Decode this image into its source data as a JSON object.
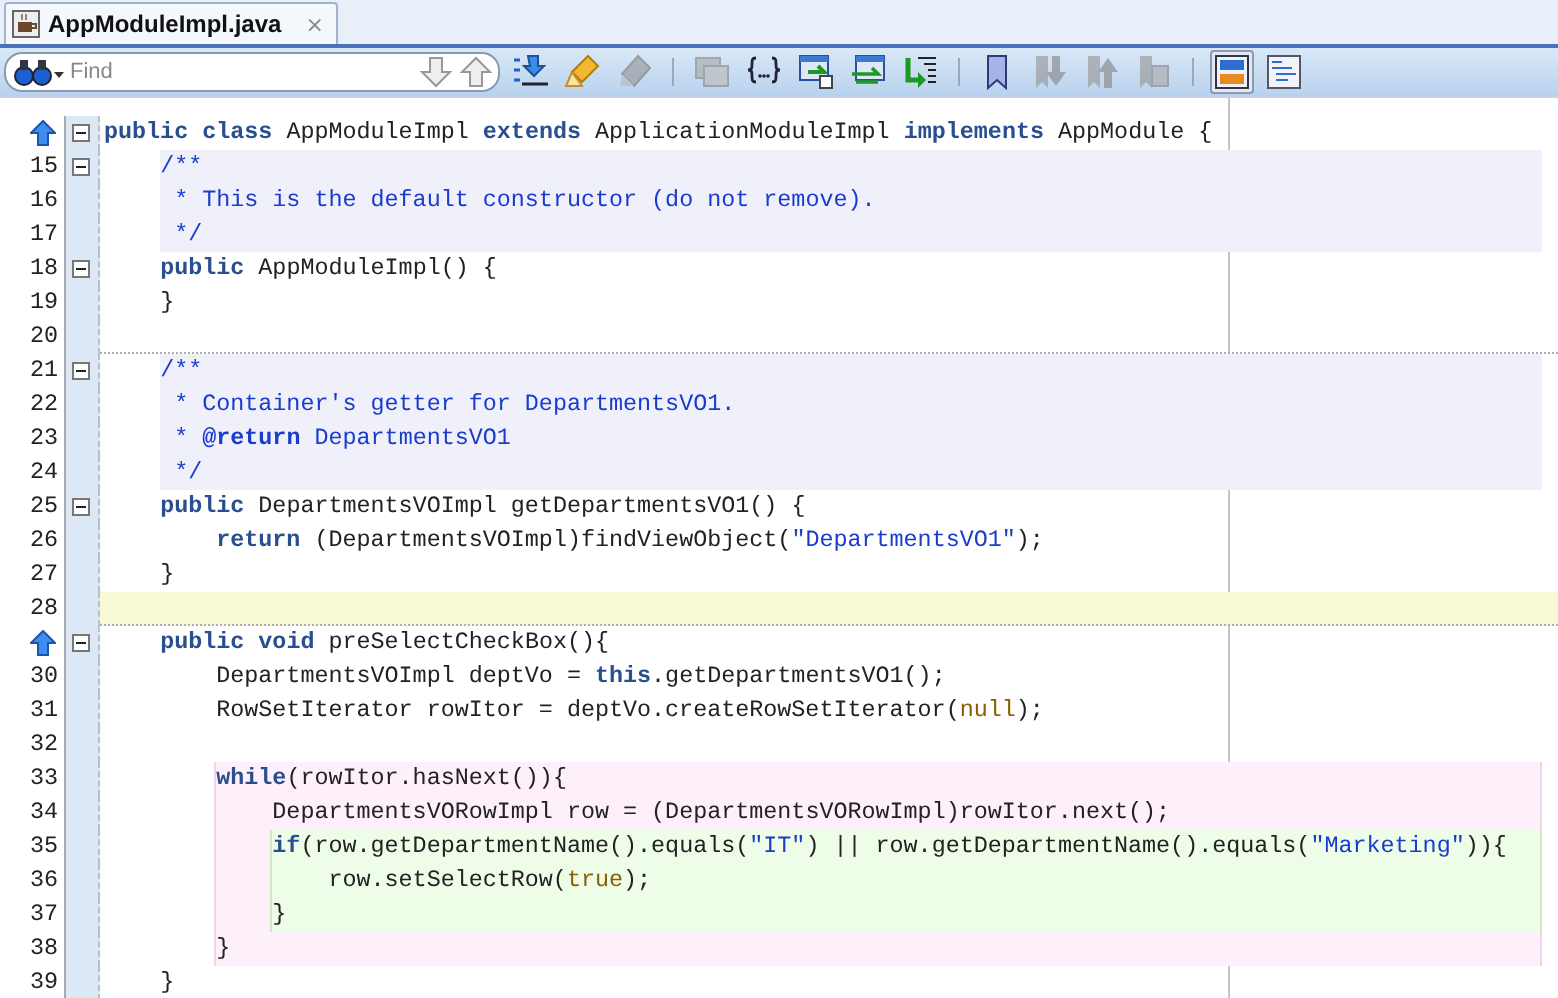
{
  "tabs": [
    {
      "label": "AppModuleImpl.java",
      "selected": true,
      "close": "×"
    }
  ],
  "find": {
    "placeholder": "Find"
  },
  "toolbar": [
    {
      "kind": "find-list",
      "disabled": false,
      "selected": false
    },
    {
      "kind": "highlight",
      "disabled": false,
      "selected": false
    },
    {
      "kind": "clear-highlight",
      "disabled": true,
      "selected": false
    },
    {
      "kind": "sep"
    },
    {
      "kind": "shift",
      "disabled": true,
      "selected": false
    },
    {
      "kind": "braces",
      "disabled": false,
      "selected": false
    },
    {
      "kind": "window-back",
      "disabled": false,
      "selected": false
    },
    {
      "kind": "window-swap",
      "disabled": false,
      "selected": false
    },
    {
      "kind": "format",
      "disabled": false,
      "selected": false
    },
    {
      "kind": "sep"
    },
    {
      "kind": "bookmark",
      "disabled": false,
      "selected": false
    },
    {
      "kind": "bookmark-down",
      "disabled": true,
      "selected": false
    },
    {
      "kind": "bookmark-up",
      "disabled": true,
      "selected": false
    },
    {
      "kind": "bookmark-clear",
      "disabled": true,
      "selected": false
    },
    {
      "kind": "sep"
    },
    {
      "kind": "split",
      "disabled": false,
      "selected": true
    },
    {
      "kind": "outline",
      "disabled": false,
      "selected": false
    }
  ],
  "lines": [
    {
      "kind": "override",
      "fold": true,
      "tokens": [
        {
          "kind": "keyword",
          "text": "public"
        },
        {
          "kind": "keyword",
          "text": " class"
        },
        {
          "kind": "plain",
          "text": " AppModuleImpl "
        },
        {
          "kind": "keyword",
          "text": "extends"
        },
        {
          "kind": "plain",
          "text": " ApplicationModuleImpl "
        },
        {
          "kind": "keyword",
          "text": "implements"
        },
        {
          "kind": "plain",
          "text": " AppModule {"
        }
      ]
    },
    {
      "kind": "numbered",
      "number": "15",
      "fold": true,
      "doc_block": true,
      "tokens": [
        {
          "kind": "comment",
          "text": "    /**"
        }
      ]
    },
    {
      "kind": "numbered",
      "number": "16",
      "fold": false,
      "doc_block": true,
      "tokens": [
        {
          "kind": "comment",
          "text": "     * This is the default constructor (do not remove)."
        }
      ]
    },
    {
      "kind": "numbered",
      "number": "17",
      "fold": false,
      "doc_block": true,
      "tokens": [
        {
          "kind": "comment",
          "text": "     */"
        }
      ]
    },
    {
      "kind": "numbered",
      "number": "18",
      "fold": true,
      "tokens": [
        {
          "kind": "keyword",
          "text": "    public"
        },
        {
          "kind": "plain",
          "text": " AppModuleImpl() {"
        }
      ]
    },
    {
      "kind": "numbered",
      "number": "19",
      "fold": false,
      "tokens": [
        {
          "kind": "plain",
          "text": "    }"
        }
      ]
    },
    {
      "kind": "numbered",
      "number": "20",
      "fold": false,
      "separator": true
    },
    {
      "kind": "numbered",
      "number": "21",
      "fold": true,
      "doc_block": true,
      "tokens": [
        {
          "kind": "comment",
          "text": "    /**"
        }
      ]
    },
    {
      "kind": "numbered",
      "number": "22",
      "fold": false,
      "doc_block": true,
      "tokens": [
        {
          "kind": "comment",
          "text": "     * Container's getter for DepartmentsVO1."
        }
      ]
    },
    {
      "kind": "numbered",
      "number": "23",
      "fold": false,
      "doc_block": true,
      "tokens": [
        {
          "kind": "comment",
          "text": "     * "
        },
        {
          "kind": "doctag",
          "text": "@return"
        },
        {
          "kind": "comment",
          "text": " DepartmentsVO1"
        }
      ]
    },
    {
      "kind": "numbered",
      "number": "24",
      "fold": false,
      "doc_block": true,
      "tokens": [
        {
          "kind": "comment",
          "text": "     */"
        }
      ]
    },
    {
      "kind": "numbered",
      "number": "25",
      "fold": true,
      "tokens": [
        {
          "kind": "keyword",
          "text": "    public"
        },
        {
          "kind": "plain",
          "text": " DepartmentsVOImpl getDepartmentsVO1() {"
        }
      ]
    },
    {
      "kind": "numbered",
      "number": "26",
      "fold": false,
      "tokens": [
        {
          "kind": "keyword",
          "text": "        return"
        },
        {
          "kind": "plain",
          "text": " (DepartmentsVOImpl)findViewObject("
        },
        {
          "kind": "string",
          "text": "\"DepartmentsVO1\""
        },
        {
          "kind": "plain",
          "text": ");"
        }
      ]
    },
    {
      "kind": "numbered",
      "number": "27",
      "fold": false,
      "tokens": [
        {
          "kind": "plain",
          "text": "    }"
        }
      ]
    },
    {
      "kind": "numbered",
      "number": "28",
      "fold": false,
      "current": true,
      "separator": true
    },
    {
      "kind": "override",
      "fold": true,
      "tokens": [
        {
          "kind": "keyword",
          "text": "    public"
        },
        {
          "kind": "keyword",
          "text": " void"
        },
        {
          "kind": "plain",
          "text": " preSelectCheckBox(){"
        }
      ]
    },
    {
      "kind": "numbered",
      "number": "30",
      "fold": false,
      "tokens": [
        {
          "kind": "plain",
          "text": "        DepartmentsVOImpl deptVo = "
        },
        {
          "kind": "keyword",
          "text": "this"
        },
        {
          "kind": "plain",
          "text": ".getDepartmentsVO1();"
        }
      ]
    },
    {
      "kind": "numbered",
      "number": "31",
      "fold": false,
      "tokens": [
        {
          "kind": "plain",
          "text": "        RowSetIterator rowItor = deptVo.createRowSetIterator("
        },
        {
          "kind": "literal",
          "text": "null"
        },
        {
          "kind": "plain",
          "text": ");"
        }
      ]
    },
    {
      "kind": "numbered",
      "number": "32",
      "fold": false
    },
    {
      "kind": "numbered",
      "number": "33",
      "fold": false,
      "loop_block": true,
      "tokens": [
        {
          "kind": "keyword",
          "text": "        while"
        },
        {
          "kind": "plain",
          "text": "(rowItor.hasNext()){"
        }
      ]
    },
    {
      "kind": "numbered",
      "number": "34",
      "fold": false,
      "loop_block": true,
      "tokens": [
        {
          "kind": "plain",
          "text": "            DepartmentsVORowImpl row = (DepartmentsVORowImpl)rowItor.next();"
        }
      ]
    },
    {
      "kind": "numbered",
      "number": "35",
      "fold": false,
      "loop_block": true,
      "if_block": true,
      "tokens": [
        {
          "kind": "keyword",
          "text": "            if"
        },
        {
          "kind": "plain",
          "text": "(row.getDepartmentName().equals("
        },
        {
          "kind": "string",
          "text": "\"IT\""
        },
        {
          "kind": "plain",
          "text": ") || row.getDepartmentName().equals("
        },
        {
          "kind": "string",
          "text": "\"Marketing\""
        },
        {
          "kind": "plain",
          "text": ")){"
        }
      ]
    },
    {
      "kind": "numbered",
      "number": "36",
      "fold": false,
      "loop_block": true,
      "if_block": true,
      "tokens": [
        {
          "kind": "plain",
          "text": "                row.setSelectRow("
        },
        {
          "kind": "literal",
          "text": "true"
        },
        {
          "kind": "plain",
          "text": ");"
        }
      ]
    },
    {
      "kind": "numbered",
      "number": "37",
      "fold": false,
      "loop_block": true,
      "if_block": true,
      "tokens": [
        {
          "kind": "plain",
          "text": "            }"
        }
      ]
    },
    {
      "kind": "numbered",
      "number": "38",
      "fold": false,
      "loop_block": true,
      "tokens": [
        {
          "kind": "plain",
          "text": "        }"
        }
      ]
    },
    {
      "kind": "numbered",
      "number": "39",
      "fold": false,
      "tokens": [
        {
          "kind": "plain",
          "text": "    }"
        }
      ]
    }
  ]
}
